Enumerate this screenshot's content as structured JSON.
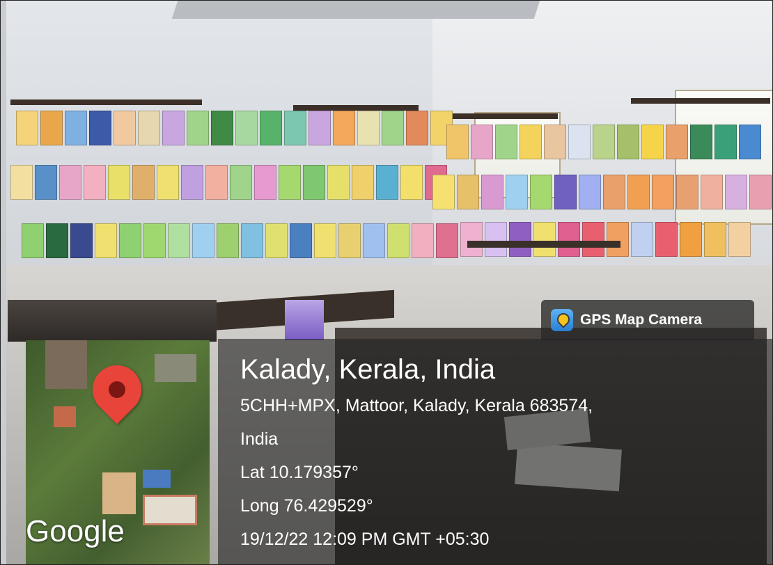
{
  "overlay": {
    "app_label": "GPS Map Camera",
    "app_icon": "gps-map-camera-icon",
    "location_title": "Kalady, Kerala, India",
    "address_line1": "5CHH+MPX, Mattoor, Kalady, Kerala 683574,",
    "address_line2": "India",
    "latitude": "Lat 10.179357°",
    "longitude": "Long 76.429529°",
    "timestamp": "19/12/22 12:09 PM GMT +05:30"
  },
  "map": {
    "provider_label": "Google",
    "pin_icon": "map-pin-icon",
    "pin_color": "#e8443a"
  }
}
